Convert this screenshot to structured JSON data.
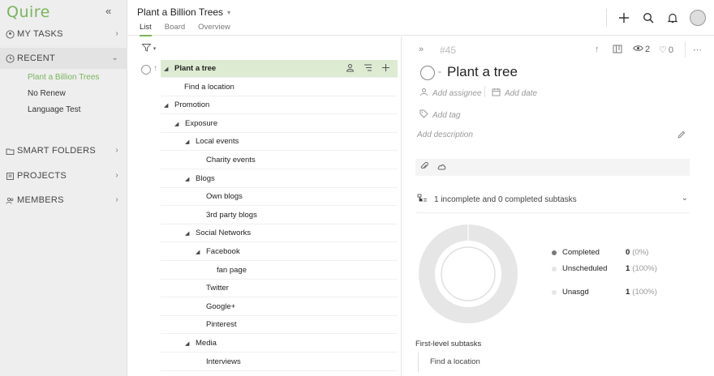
{
  "sidebar": {
    "logo": "Quire",
    "sections": {
      "my_tasks": "MY TASKS",
      "recent": "RECENT",
      "smart_folders": "SMART FOLDERS",
      "projects": "PROJECTS",
      "members": "MEMBERS"
    },
    "recent_items": [
      "Plant a Billion Trees",
      "No Renew",
      "Language Test"
    ]
  },
  "header": {
    "project_title": "Plant a Billion Trees",
    "tabs": [
      "List",
      "Board",
      "Overview"
    ]
  },
  "tasks": [
    {
      "label": "Plant a tree"
    },
    {
      "label": "Find a location"
    },
    {
      "label": "Promotion"
    },
    {
      "label": "Exposure"
    },
    {
      "label": "Local events"
    },
    {
      "label": "Charity events"
    },
    {
      "label": "Blogs"
    },
    {
      "label": "Own blogs"
    },
    {
      "label": "3rd party blogs"
    },
    {
      "label": "Social Networks"
    },
    {
      "label": "Facebook"
    },
    {
      "label": "fan page"
    },
    {
      "label": "Twitter"
    },
    {
      "label": "Google+"
    },
    {
      "label": "Pinterest"
    },
    {
      "label": "Media"
    },
    {
      "label": "Interviews"
    }
  ],
  "detail": {
    "task_number": "#45",
    "title": "Plant a tree",
    "watchers": "2",
    "likes": "0",
    "add_assignee": "Add assignee",
    "add_date": "Add date",
    "add_tag": "Add tag",
    "add_description": "Add description",
    "subtasks_summary": "1 incomplete and 0 completed subtasks",
    "legend": [
      {
        "label": "Completed",
        "count": "0",
        "pct": "(0%)",
        "color": "#777777"
      },
      {
        "label": "Unscheduled",
        "count": "1",
        "pct": "(100%)",
        "color": "#e6e6e6"
      },
      {
        "label": "Unasgd",
        "count": "1",
        "pct": "(100%)",
        "color": "#e6e6e6"
      }
    ],
    "first_level_title": "First-level subtasks",
    "first_level_items": [
      "Find a location"
    ]
  },
  "colors": {
    "accent": "#7ab45c",
    "selected_row": "#ddebd2",
    "sidebar_bg": "#eeeeee"
  }
}
